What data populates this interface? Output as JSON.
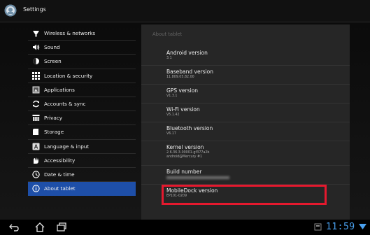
{
  "titlebar": {
    "title": "Settings",
    "icon": "settings-app-icon"
  },
  "sidebar": {
    "items": [
      {
        "label": "Wireless & networks",
        "icon": "wifi-icon"
      },
      {
        "label": "Sound",
        "icon": "speaker-icon"
      },
      {
        "label": "Screen",
        "icon": "brightness-icon"
      },
      {
        "label": "Location & security",
        "icon": "grid-lock-icon"
      },
      {
        "label": "Applications",
        "icon": "applications-icon"
      },
      {
        "label": "Accounts & sync",
        "icon": "sync-icon"
      },
      {
        "label": "Privacy",
        "icon": "privacy-icon"
      },
      {
        "label": "Storage",
        "icon": "storage-icon"
      },
      {
        "label": "Language & input",
        "icon": "language-icon"
      },
      {
        "label": "Accessibility",
        "icon": "accessibility-icon"
      },
      {
        "label": "Date & time",
        "icon": "clock-icon"
      },
      {
        "label": "About tablet",
        "icon": "info-icon",
        "selected": true
      }
    ]
  },
  "panel": {
    "title": "About tablet",
    "rows": [
      {
        "title": "Android version",
        "value": "3.1"
      },
      {
        "title": "Baseband version",
        "value": "11.809.05.82.00"
      },
      {
        "title": "GPS version",
        "value": "V1.3.1"
      },
      {
        "title": "Wi-Fi version",
        "value": "V5.1.42"
      },
      {
        "title": "Bluetooth version",
        "value": "V6.17"
      },
      {
        "title": "Kernel version",
        "value": "2.6.36.3-00001-gf377a2b\nandroid@Mercury #1"
      },
      {
        "title": "Build number",
        "value": ""
      },
      {
        "title": "MobileDock version",
        "value": "EP101-0209"
      }
    ]
  },
  "statusbar": {
    "time": "11:59",
    "clock_color": "#49a0ee",
    "nav": [
      "back-icon",
      "home-icon",
      "recent-apps-icon"
    ]
  },
  "colors": {
    "selected": "#1e4fa8",
    "highlight_box": "#e5192e"
  }
}
